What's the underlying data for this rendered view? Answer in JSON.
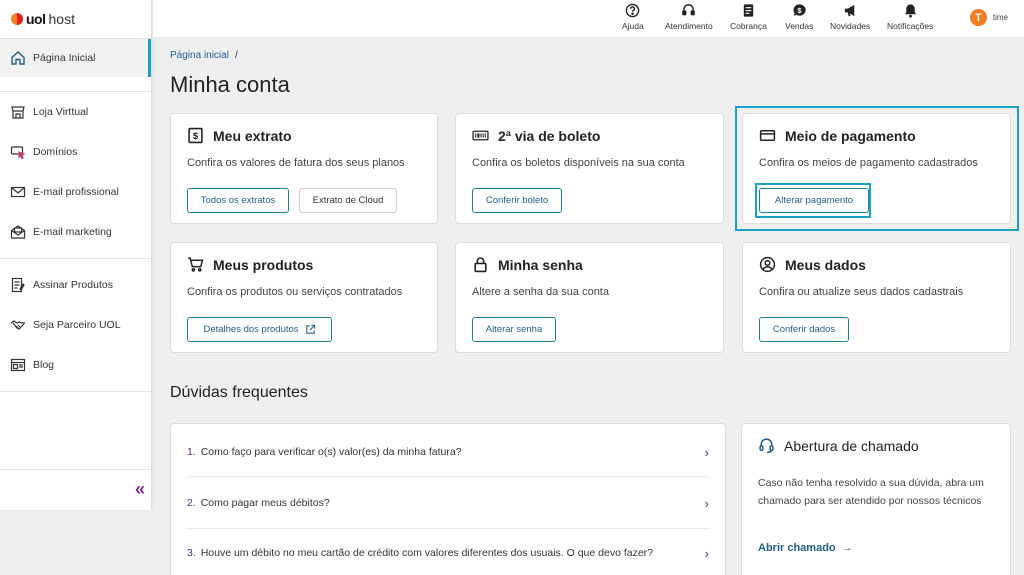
{
  "brand": {
    "logo_bold": "uol",
    "logo_light": "host"
  },
  "sidebar": {
    "items": [
      {
        "label": "Página Inicial",
        "icon": "home-icon"
      },
      {
        "label": "Loja Virttual",
        "icon": "store-icon"
      },
      {
        "label": "Domínios",
        "icon": "domain-cursor-icon"
      },
      {
        "label": "E-mail profissional",
        "icon": "envelope-icon"
      },
      {
        "label": "E-mail marketing",
        "icon": "envelope-open-icon"
      },
      {
        "label": "Assinar Produtos",
        "icon": "sign-document-icon"
      },
      {
        "label": "Seja Parceiro UOL",
        "icon": "handshake-icon"
      },
      {
        "label": "Blog",
        "icon": "blog-icon"
      }
    ],
    "collapse_label": "«"
  },
  "topbar": {
    "items": [
      {
        "label": "Ajuda",
        "icon": "help-icon"
      },
      {
        "label": "Atendimento",
        "icon": "headset-icon"
      },
      {
        "label": "Cobrança",
        "icon": "invoice-icon"
      },
      {
        "label": "Vendas",
        "icon": "sales-chat-icon"
      },
      {
        "label": "Novidades",
        "icon": "megaphone-icon"
      },
      {
        "label": "Notificações",
        "icon": "bell-icon"
      }
    ],
    "user": {
      "avatar_letter": "T",
      "name": "time"
    }
  },
  "breadcrumb": {
    "home": "Página inicial",
    "sep": "/"
  },
  "page_title": "Minha conta",
  "cards": {
    "extrato": {
      "title": "Meu extrato",
      "desc": "Confira os valores de fatura dos seus planos",
      "btn1": "Todos os extratos",
      "btn2": "Extrato de Cloud"
    },
    "boleto": {
      "title": "2ª via de boleto",
      "desc": "Confira os boletos disponíveis na sua conta",
      "btn1": "Conferir boleto"
    },
    "pagamento": {
      "title": "Meio de pagamento",
      "desc": "Confira os meios de pagamento cadastrados",
      "btn1": "Alterar pagamento"
    },
    "produtos": {
      "title": "Meus produtos",
      "desc": "Confira os produtos ou serviços contratados",
      "btn1": "Detalhes dos produtos"
    },
    "senha": {
      "title": "Minha senha",
      "desc": "Altere a senha da sua conta",
      "btn1": "Alterar senha"
    },
    "dados": {
      "title": "Meus dados",
      "desc": "Confira ou atualize seus dados cadastrais",
      "btn1": "Conferir dados"
    }
  },
  "faq": {
    "title": "Dúvidas frequentes",
    "items": [
      {
        "num": "1.",
        "text": "Como faço para verificar o(s) valor(es) da minha fatura?"
      },
      {
        "num": "2.",
        "text": "Como pagar meus débitos?"
      },
      {
        "num": "3.",
        "text": "Houve um débito no meu cartão de crédito com valores diferentes dos usuais. O que devo fazer?"
      }
    ]
  },
  "support": {
    "title": "Abertura de chamado",
    "text": "Caso não tenha resolvido a sua dúvida, abra um chamado para ser atendido por nossos técnicos",
    "link": "Abrir chamado"
  },
  "colors": {
    "accent": "#1ba0c6",
    "link": "#1f5f86",
    "purple": "#5a2d82"
  }
}
